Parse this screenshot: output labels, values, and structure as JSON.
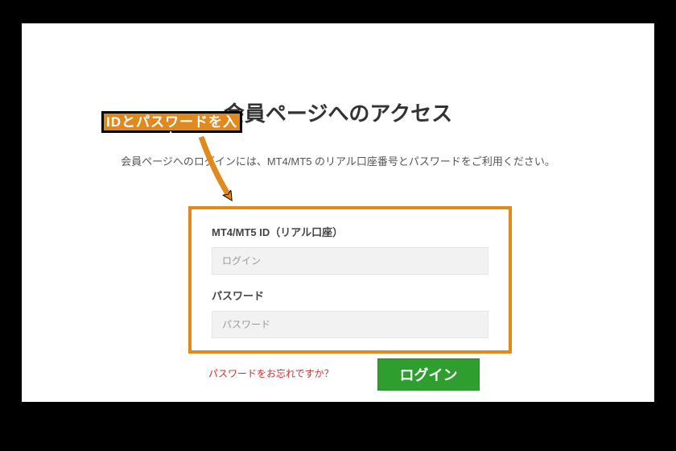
{
  "title": "会員ページへのアクセス",
  "subtitle": "会員ページへのログインには、MT4/MT5 のリアル口座番号とパスワードをご利用ください。",
  "callout": "IDとパスワードを入力",
  "form": {
    "id_label": "MT4/MT5 ID（リアル口座）",
    "id_placeholder": "ログイン",
    "password_label": "パスワード",
    "password_placeholder": "パスワード"
  },
  "forgot_link": "パスワードをお忘れですか？",
  "login_button": "ログイン"
}
